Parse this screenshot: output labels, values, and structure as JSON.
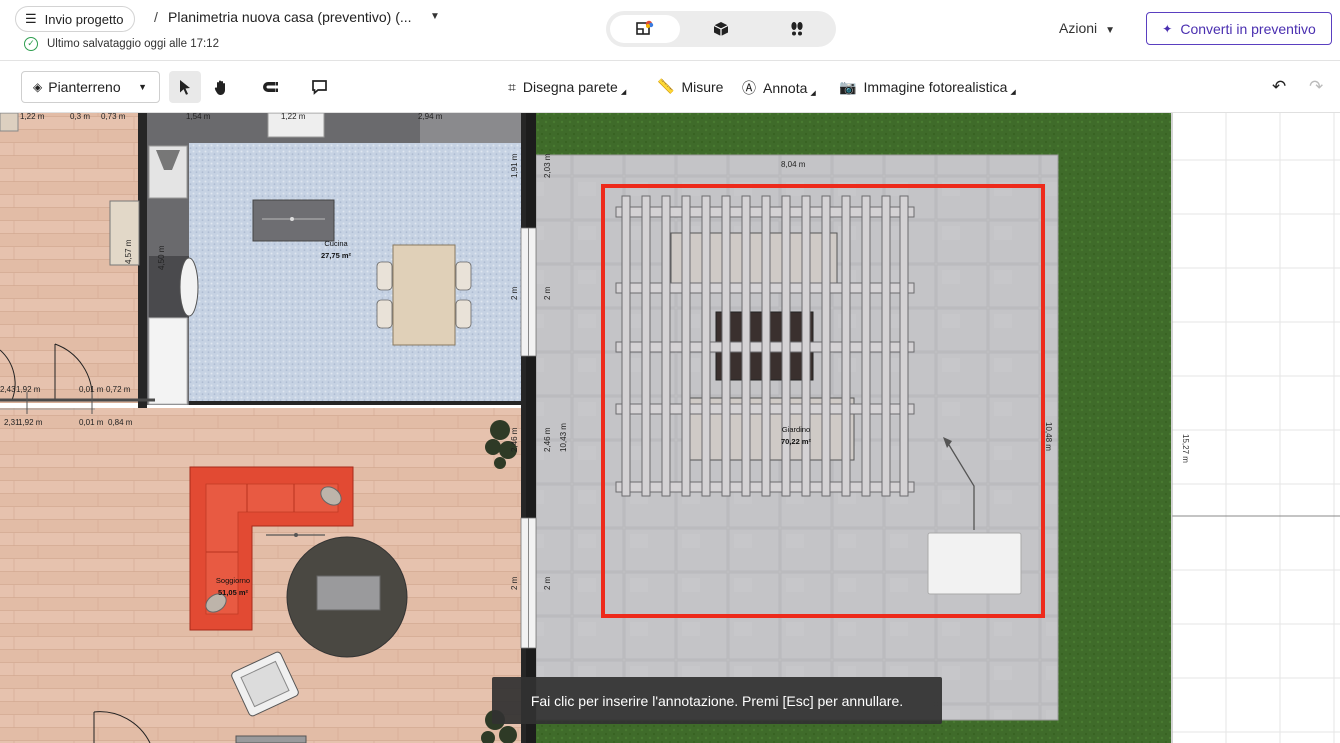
{
  "header": {
    "project_button": "Invio progetto",
    "separator": "/",
    "project_title": "Planimetria nuova casa (preventivo) (...",
    "save_status": "Ultimo salvataggio oggi alle 17:12",
    "actions_label": "Azioni",
    "convert_label": "Converti in preventivo"
  },
  "view_switch": [
    "2d-plan-icon",
    "3d-box-icon",
    "walkthrough-footsteps-icon"
  ],
  "toolbar": {
    "floor_label": "Pianterreno",
    "draw_wall": "Disegna parete",
    "measures": "Misure",
    "annotate": "Annota",
    "photo": "Immagine fotorealistica"
  },
  "plan": {
    "rooms": [
      {
        "name": "Cucina",
        "area": "27,75 m²"
      },
      {
        "name": "Soggiorno",
        "area": "51,05 m²"
      },
      {
        "name": "Giardino",
        "area": "70,22 m²"
      }
    ],
    "dimensions": {
      "top_122a": "1,22 m",
      "top_03": "0,3 m",
      "top_073": "0,73 m",
      "top_154": "1,54 m",
      "top_122b": "1,22 m",
      "top_294": "2,94 m",
      "garden_width": "8,04 m",
      "side_191": "1,91 m",
      "side_203": "2,03 m",
      "side_2m_a": "2 m",
      "side_2m_b": "2 m",
      "side_246a": "2,46 m",
      "side_246b": "2,46 m",
      "side_1043": "10,43 m",
      "side_2m_c": "2 m",
      "side_2m_d": "2 m",
      "right_1048": "10,48 m",
      "far_right_1527": "15,27 m",
      "left_457": "4,57 m",
      "left_450": "4,50 m",
      "door_243": "2,43",
      "door_192": "1,92 m",
      "door_001a": "0,01 m",
      "door_072": "0,72 m",
      "door_231": "2,31",
      "door_192b": "1,92 m",
      "door_001b": "0,01 m",
      "door_084": "0,84 m"
    }
  },
  "colors": {
    "annotation_frame": "#ee2a1b",
    "grass": "#3f6b2a",
    "sofa": "#e24a33",
    "accent": "#4a2fb0"
  },
  "toast": "Fai clic per inserire l'annotazione. Premi [Esc] per annullare."
}
